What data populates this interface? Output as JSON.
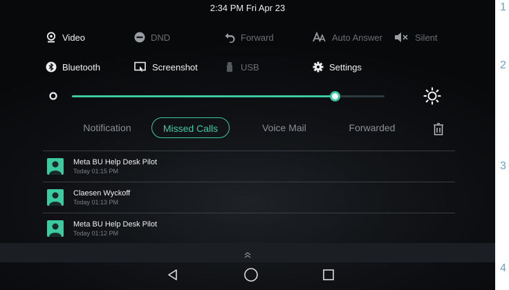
{
  "status": {
    "datetime": "2:34 PM Fri Apr 23"
  },
  "quick": {
    "row1": [
      {
        "label": "Video",
        "icon": "video-icon",
        "state": "on"
      },
      {
        "label": "DND",
        "icon": "dnd-icon",
        "state": "off"
      },
      {
        "label": "Forward",
        "icon": "forward-icon",
        "state": "off"
      },
      {
        "label": "Auto Answer",
        "icon": "auto-answer-icon",
        "state": "off"
      },
      {
        "label": "Silent",
        "icon": "silent-icon",
        "state": "off"
      }
    ],
    "row2": [
      {
        "label": "Bluetooth",
        "icon": "bluetooth-icon",
        "state": "on"
      },
      {
        "label": "Screenshot",
        "icon": "screenshot-icon",
        "state": "on"
      },
      {
        "label": "USB",
        "icon": "usb-icon",
        "state": "off"
      },
      {
        "label": "Settings",
        "icon": "settings-icon",
        "state": "on"
      }
    ]
  },
  "brightness": {
    "level": 0.84,
    "accent": "#3ccaa0"
  },
  "tabs": [
    {
      "label": "Notification",
      "active": false
    },
    {
      "label": "Missed Calls",
      "active": true
    },
    {
      "label": "Voice Mail",
      "active": false
    },
    {
      "label": "Forwarded",
      "active": false
    }
  ],
  "missed_calls": [
    {
      "name": "Meta BU Help Desk Pilot",
      "time": "Today 01:15 PM"
    },
    {
      "name": "Claesen Wyckoff",
      "time": "Today 01:13 PM"
    },
    {
      "name": "Meta BU Help Desk Pilot",
      "time": "Today 01:12 PM"
    }
  ],
  "side_numbers": [
    "1",
    "2",
    "3",
    "4"
  ]
}
